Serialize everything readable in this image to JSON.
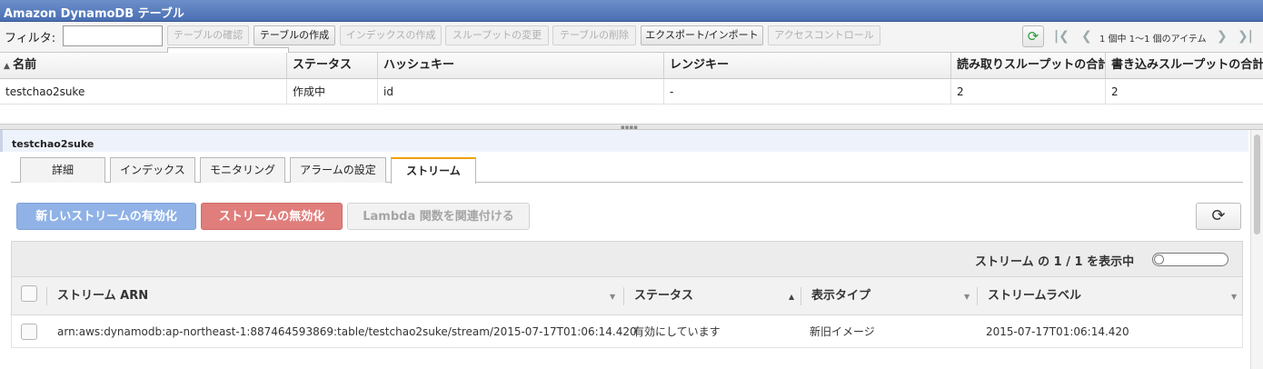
{
  "window": {
    "title": "Amazon DynamoDB テーブル"
  },
  "toolbar": {
    "filter_label": "フィルタ:",
    "filter_value": "",
    "buttons": [
      {
        "label": "テーブルの確認",
        "disabled": true
      },
      {
        "label": "テーブルの作成",
        "disabled": false
      },
      {
        "label": "インデックスの作成",
        "disabled": true
      },
      {
        "label": "スループットの変更",
        "disabled": true
      },
      {
        "label": "テーブルの削除",
        "disabled": true
      },
      {
        "label": "エクスポート/インポート",
        "disabled": false
      },
      {
        "label": "アクセスコントロール",
        "disabled": true
      }
    ],
    "pager_text": "1 個中 1〜1 個のアイテム"
  },
  "table_grid": {
    "columns": [
      "名前",
      "ステータス",
      "ハッシュキー",
      "レンジキー",
      "読み取りスループットの合計",
      "書き込みスループットの合計"
    ],
    "rows": [
      [
        "testchao2suke",
        "作成中",
        "id",
        "-",
        "2",
        "2"
      ]
    ]
  },
  "detail": {
    "title": "testchao2suke",
    "tabs": [
      "詳細",
      "インデックス",
      "モニタリング",
      "アラームの設定",
      "ストリーム"
    ],
    "active_tab": "ストリーム",
    "stream_buttons": {
      "enable": "新しいストリームの有効化",
      "disable": "ストリームの無効化",
      "lambda": "Lambda 関数を関連付ける"
    },
    "list_count": "ストリーム の 1 / 1 を表示中",
    "stream_table": {
      "columns": [
        "ストリーム ARN",
        "ステータス",
        "表示タイプ",
        "ストリームラベル"
      ],
      "rows": [
        [
          "arn:aws:dynamodb:ap-northeast-1:887464593869:table/testchao2suke/stream/2015-07-17T01:06:14.420",
          "有効にしています",
          "新旧イメージ",
          "2015-07-17T01:06:14.420"
        ]
      ]
    }
  },
  "colors": {
    "title_bar": "#4a6fb4",
    "enable_btn": "#90b2e6",
    "disable_btn": "#e07e7c",
    "active_tab_accent": "#f0a000"
  },
  "icons": [
    "refresh-icon",
    "first-page-icon",
    "prev-page-icon",
    "next-page-icon",
    "last-page-icon",
    "reload-icon",
    "sort-asc-icon",
    "sort-desc-icon"
  ]
}
